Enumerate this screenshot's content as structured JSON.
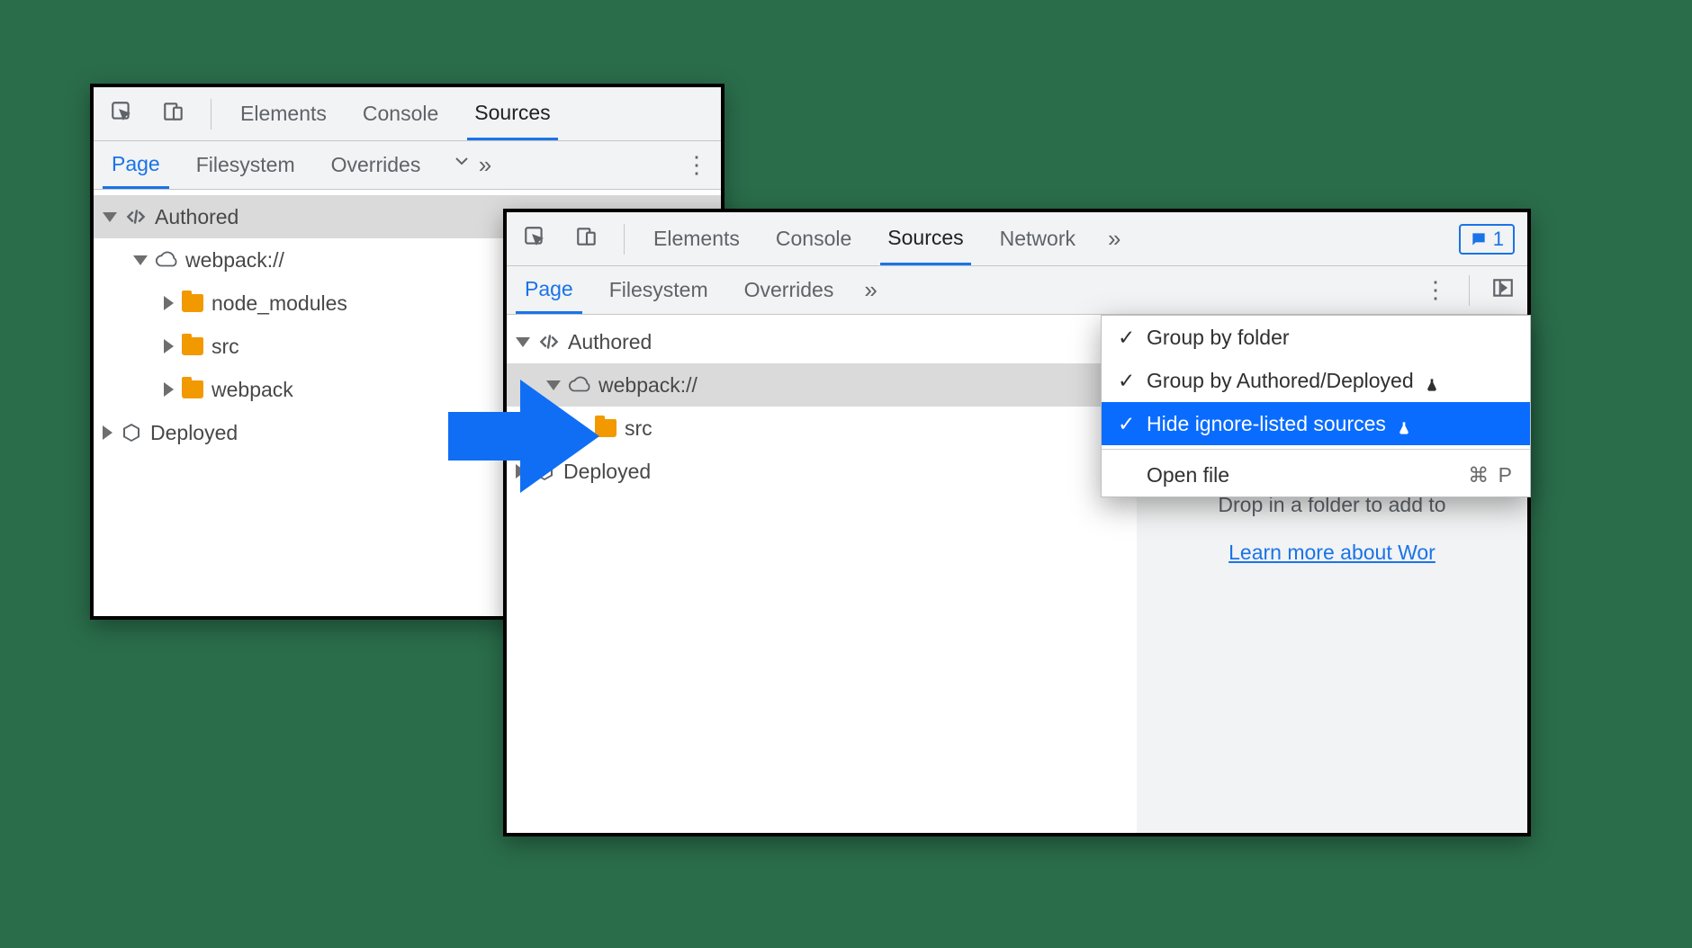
{
  "top_tabs": {
    "elements": "Elements",
    "console": "Console",
    "sources": "Sources",
    "network": "Network"
  },
  "badge": {
    "count": "1"
  },
  "sub_tabs": {
    "page": "Page",
    "filesystem": "Filesystem",
    "overrides": "Overrides"
  },
  "tree_left": {
    "authored": "Authored",
    "webpack": "webpack://",
    "node_modules": "node_modules",
    "src": "src",
    "webpack_dir": "webpack",
    "deployed": "Deployed"
  },
  "tree_right": {
    "authored": "Authored",
    "webpack": "webpack://",
    "src": "src",
    "deployed": "Deployed"
  },
  "menu": {
    "group_folder": "Group by folder",
    "group_authored": "Group by Authored/Deployed",
    "hide_ignored": "Hide ignore-listed sources",
    "open_file": "Open file",
    "open_file_key": "⌘ P"
  },
  "hint": {
    "drop": "Drop in a folder to add to",
    "learn": "Learn more about Wor"
  }
}
